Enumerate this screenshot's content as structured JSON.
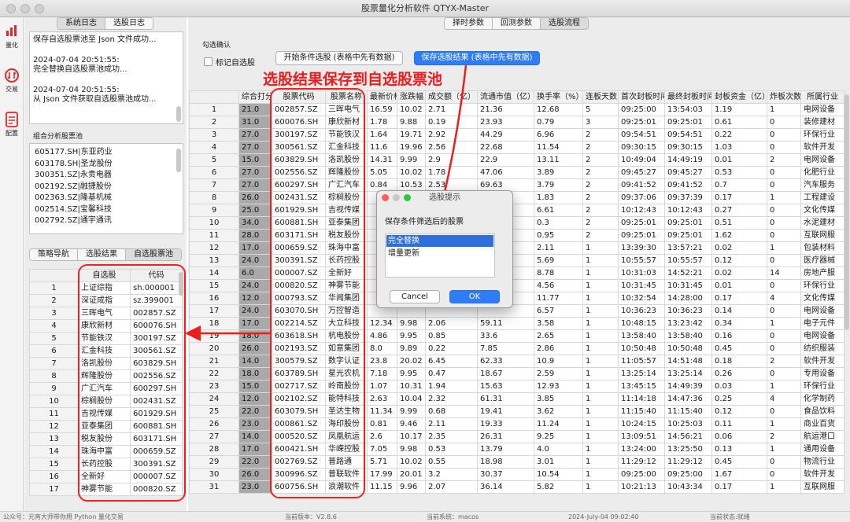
{
  "window": {
    "title": "股票量化分析软件 QTYX-Master"
  },
  "left_nav": [
    {
      "label": "量化",
      "icon": "bar-chart-icon"
    },
    {
      "label": "交易",
      "icon": "exchange-icon"
    },
    {
      "label": "配置",
      "icon": "document-icon"
    }
  ],
  "log_tabs": [
    "系统日志",
    "选股日志"
  ],
  "log_lines": [
    "保存自选股票池至 Json 文件成功...",
    "2024-07-04 20:51:55:",
    "完全替换自选股票池成功...",
    "2024-07-04 20:51:55:",
    "从 Json 文件获取自选股票池成功..."
  ],
  "combo_pool": {
    "label": "组合分析股票池",
    "items": [
      "605177.SH|东亚药业",
      "603178.SH|圣龙股份",
      "300351.SZ|永贵电器",
      "002192.SZ|融捷股份",
      "002363.SZ|隆基机械",
      "002514.SZ|宝馨科技",
      "002792.SZ|通宇通讯"
    ]
  },
  "strategy_tabs": [
    "策略导航",
    "选股结果",
    "自选股票池"
  ],
  "selfpool": {
    "headers": [
      "自选股",
      "代码"
    ],
    "rows": [
      [
        "1",
        "上证综指",
        "sh.000001"
      ],
      [
        "2",
        "深证成指",
        "sz.399001"
      ],
      [
        "3",
        "三晖电气",
        "002857.SZ"
      ],
      [
        "4",
        "康欣新材",
        "600076.SH"
      ],
      [
        "5",
        "节能铁汉",
        "300197.SZ"
      ],
      [
        "6",
        "汇金科技",
        "300561.SZ"
      ],
      [
        "7",
        "洛凯股份",
        "603829.SH"
      ],
      [
        "8",
        "辉隆股份",
        "002556.SZ"
      ],
      [
        "9",
        "广汇汽车",
        "600297.SH"
      ],
      [
        "10",
        "棕榈股份",
        "002431.SZ"
      ],
      [
        "11",
        "吉视传媒",
        "601929.SH"
      ],
      [
        "12",
        "亚泰集团",
        "600881.SH"
      ],
      [
        "13",
        "税友股份",
        "603171.SH"
      ],
      [
        "14",
        "珠海中富",
        "000659.SZ"
      ],
      [
        "15",
        "长药控股",
        "300391.SZ"
      ],
      [
        "16",
        "全新好",
        "000007.SZ"
      ],
      [
        "17",
        "神雾节能",
        "000820.SZ"
      ]
    ]
  },
  "top_tabs": [
    "择时参数",
    "回测参数",
    "选股流程"
  ],
  "confirm": {
    "group_label": "勾选确认",
    "checkbox_label": "标记自选股",
    "start_button": "开始条件选股 (表格中先有数据)",
    "save_button": "保存选股结果 (表格中先有数据)"
  },
  "annotation": "选股结果保存到自选股票池",
  "result_table": {
    "headers": [
      "",
      "综合打分",
      "股票代码",
      "股票名称",
      "最新价格",
      "涨跌幅",
      "成交额（亿）",
      "流通市值（亿）",
      "换手率（%）",
      "连板天数",
      "首次封板时间",
      "最终封板时间",
      "封板资金（亿）",
      "炸板次数",
      "所属行业"
    ],
    "rows": [
      [
        "1",
        "21.0",
        "002857.SZ",
        "三晖电气",
        "16.59",
        "10.02",
        "2.71",
        "21.36",
        "12.68",
        "5",
        "09:25:00",
        "13:54:03",
        "1.19",
        "1",
        "电网设备"
      ],
      [
        "2",
        "31.0",
        "600076.SH",
        "康欣新材",
        "1.78",
        "9.88",
        "0.19",
        "23.93",
        "0.79",
        "3",
        "09:25:01",
        "09:25:01",
        "0.61",
        "0",
        "装修建材"
      ],
      [
        "3",
        "27.0",
        "300197.SZ",
        "节能铁汉",
        "1.64",
        "19.71",
        "2.92",
        "44.29",
        "6.96",
        "2",
        "09:54:51",
        "09:54:51",
        "0.22",
        "0",
        "环保行业"
      ],
      [
        "4",
        "27.0",
        "300561.SZ",
        "汇金科技",
        "11.6",
        "19.96",
        "2.56",
        "22.68",
        "11.54",
        "2",
        "09:30:15",
        "09:30:15",
        "1.03",
        "0",
        "软件开发"
      ],
      [
        "5",
        "15.0",
        "603829.SH",
        "洛凯股份",
        "14.31",
        "9.99",
        "2.9",
        "22.9",
        "13.11",
        "2",
        "10:49:04",
        "14:49:19",
        "0.01",
        "2",
        "电网设备"
      ],
      [
        "6",
        "27.0",
        "002556.SZ",
        "辉隆股份",
        "5.05",
        "10.02",
        "1.78",
        "47.06",
        "3.89",
        "2",
        "09:45:27",
        "09:45:27",
        "0.53",
        "0",
        "化肥行业"
      ],
      [
        "7",
        "27.0",
        "600297.SH",
        "广汇汽车",
        "0.84",
        "10.53",
        "2.53",
        "69.63",
        "3.79",
        "2",
        "09:41:52",
        "09:41:52",
        "0.7",
        "0",
        "汽车服务"
      ],
      [
        "8",
        "26.0",
        "002431.SZ",
        "棕榈股份",
        "",
        "",
        "",
        "",
        "1.83",
        "2",
        "09:37:06",
        "09:37:39",
        "0.17",
        "1",
        "工程建设"
      ],
      [
        "9",
        "25.0",
        "601929.SH",
        "吉视传媒",
        "",
        "",
        "",
        "",
        "6.61",
        "2",
        "10:12:43",
        "10:12:43",
        "0.27",
        "0",
        "文化传媒"
      ],
      [
        "10",
        "34.0",
        "600881.SH",
        "亚泰集团",
        "",
        "",
        "",
        "",
        "0.3",
        "2",
        "09:25:01",
        "09:25:01",
        "0.51",
        "0",
        "水泥建材"
      ],
      [
        "11",
        "28.0",
        "603171.SH",
        "税友股份",
        "",
        "",
        "",
        "",
        "0.95",
        "2",
        "09:25:01",
        "09:25:01",
        "1.62",
        "0",
        "互联网服"
      ],
      [
        "12",
        "17.0",
        "000659.SZ",
        "珠海中富",
        "",
        "",
        "",
        "",
        "2.11",
        "1",
        "13:39:30",
        "13:57:21",
        "0.02",
        "1",
        "包装材料"
      ],
      [
        "13",
        "24.0",
        "300391.SZ",
        "长药控股",
        "",
        "",
        "",
        "",
        "5.69",
        "1",
        "10:55:57",
        "10:55:57",
        "0.12",
        "0",
        "医疗器械"
      ],
      [
        "14",
        "6.0",
        "000007.SZ",
        "全新好",
        "",
        "",
        "",
        "",
        "8.78",
        "1",
        "10:31:03",
        "14:52:21",
        "0.02",
        "14",
        "房地产服"
      ],
      [
        "15",
        "24.0",
        "000820.SZ",
        "神雾节能",
        "",
        "",
        "",
        "",
        "4.56",
        "1",
        "10:31:45",
        "10:31:45",
        "0.01",
        "0",
        "环保行业"
      ],
      [
        "16",
        "12.0",
        "000793.SZ",
        "华闻集团",
        "",
        "",
        "",
        "",
        "11.77",
        "1",
        "10:32:54",
        "14:28:00",
        "0.17",
        "4",
        "文化传媒"
      ],
      [
        "17",
        "24.0",
        "603070.SH",
        "万控智造",
        "",
        "",
        "",
        "",
        "6.57",
        "1",
        "10:36:23",
        "10:36:23",
        "0.14",
        "0",
        "电网设备"
      ],
      [
        "18",
        "17.0",
        "002214.SZ",
        "大立科技",
        "12.34",
        "9.98",
        "2.06",
        "59.11",
        "3.58",
        "1",
        "10:48:15",
        "13:23:42",
        "0.34",
        "1",
        "电子元件"
      ],
      [
        "19",
        "18.0",
        "603618.SH",
        "杭电股份",
        "4.86",
        "9.95",
        "0.85",
        "33.6",
        "2.65",
        "1",
        "13:58:40",
        "13:58:40",
        "0.16",
        "0",
        "电网设备"
      ],
      [
        "20",
        "26.0",
        "002193.SZ",
        "如意集团",
        "8.0",
        "9.89",
        "0.22",
        "7.85",
        "2.86",
        "1",
        "10:50:48",
        "10:50:48",
        "0.45",
        "0",
        "纺织服装"
      ],
      [
        "21",
        "14.0",
        "300579.SZ",
        "数字认证",
        "23.8",
        "20.02",
        "6.45",
        "62.33",
        "10.9",
        "1",
        "11:05:57",
        "14:51:48",
        "0.18",
        "2",
        "软件开发"
      ],
      [
        "22",
        "18.0",
        "603789.SH",
        "星光农机",
        "7.18",
        "9.95",
        "0.47",
        "18.67",
        "2.59",
        "1",
        "13:25:14",
        "13:25:14",
        "0.26",
        "0",
        "专用设备"
      ],
      [
        "23",
        "15.0",
        "002717.SZ",
        "岭南股份",
        "1.07",
        "10.31",
        "1.94",
        "15.63",
        "12.93",
        "1",
        "13:45:15",
        "14:49:39",
        "0.03",
        "1",
        "环保行业"
      ],
      [
        "24",
        "12.0",
        "002102.SZ",
        "能特科技",
        "2.63",
        "10.04",
        "2.32",
        "61.31",
        "3.85",
        "1",
        "11:14:18",
        "14:47:36",
        "0.25",
        "4",
        "化学制药"
      ],
      [
        "25",
        "22.0",
        "603079.SH",
        "圣达生物",
        "11.34",
        "9.99",
        "0.68",
        "19.41",
        "3.62",
        "1",
        "11:15:40",
        "11:15:40",
        "0.12",
        "0",
        "食品饮料"
      ],
      [
        "26",
        "23.0",
        "000861.SZ",
        "海印股份",
        "0.81",
        "9.46",
        "2.11",
        "19.33",
        "11.24",
        "1",
        "10:24:15",
        "10:25:03",
        "0.11",
        "1",
        "商业百货"
      ],
      [
        "27",
        "14.0",
        "000520.SZ",
        "凤凰航运",
        "2.6",
        "10.17",
        "2.35",
        "26.31",
        "9.25",
        "1",
        "13:09:51",
        "14:56:21",
        "0.06",
        "2",
        "航运港口"
      ],
      [
        "28",
        "17.0",
        "600421.SH",
        "华嵘控股",
        "7.05",
        "9.98",
        "0.53",
        "13.79",
        "4.0",
        "1",
        "13:24:00",
        "13:25:50",
        "0.13",
        "1",
        "通用设备"
      ],
      [
        "29",
        "22.0",
        "002769.SZ",
        "普路通",
        "5.71",
        "10.02",
        "0.55",
        "18.98",
        "3.01",
        "1",
        "11:29:12",
        "11:29:12",
        "0.45",
        "0",
        "物流行业"
      ],
      [
        "30",
        "26.0",
        "300996.SZ",
        "普联软件",
        "17.99",
        "20.01",
        "3.2",
        "30.37",
        "10.54",
        "1",
        "09:25:00",
        "09:25:00",
        "1.67",
        "0",
        "软件开发"
      ],
      [
        "31",
        "23.0",
        "600756.SH",
        "浪潮软件",
        "11.15",
        "9.96",
        "2.07",
        "36.14",
        "5.82",
        "1",
        "10:21:13",
        "10:43:34",
        "0.17",
        "1",
        "互联网服"
      ]
    ]
  },
  "dialog": {
    "title": "选股提示",
    "prompt": "保存条件筛选后的股票",
    "options": [
      "完全替换",
      "增量更新"
    ],
    "selected_option": "完全替换",
    "cancel": "Cancel",
    "ok": "OK"
  },
  "status": {
    "wechat": "公众号：元宵大师带你用 Python 量化交易",
    "version": "当前版本：V2.8.6",
    "system": "当前系统：macos",
    "time": "2024-July-04 09:02:40",
    "state": "当前状态:就绪"
  },
  "colors": {
    "accent": "#2e7cf6",
    "annotation": "#ee1c1c",
    "score_bg": "#a9a9a9"
  }
}
